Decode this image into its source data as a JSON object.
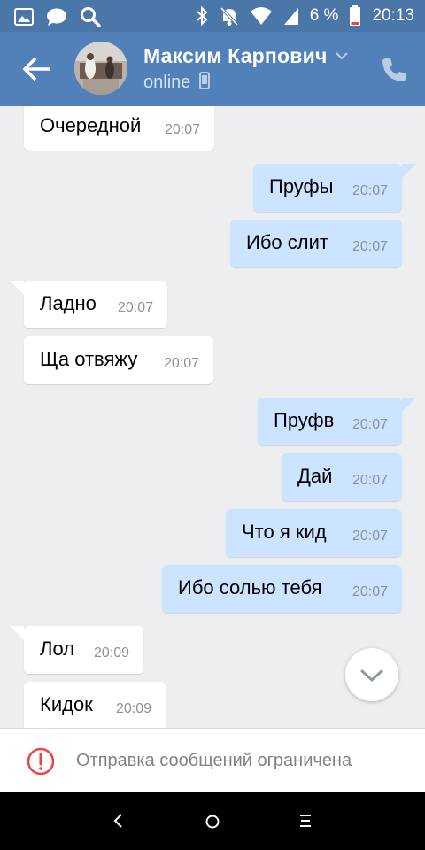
{
  "status_bar": {
    "battery_percent": "6 %",
    "time": "20:13"
  },
  "header": {
    "contact_name": "Максим Карпович",
    "presence": "online"
  },
  "messages": [
    {
      "dir": "in",
      "text": "Очередной",
      "time": "20:07"
    },
    {
      "dir": "out",
      "text": "Пруфы",
      "time": "20:07"
    },
    {
      "dir": "out",
      "text": "Ибо слит",
      "time": "20:07"
    },
    {
      "dir": "in",
      "text": "Ладно",
      "time": "20:07"
    },
    {
      "dir": "in",
      "text": "Ща отвяжу",
      "time": "20:07"
    },
    {
      "dir": "out",
      "text": "Пруфв",
      "time": "20:07"
    },
    {
      "dir": "out",
      "text": "Дай",
      "time": "20:07"
    },
    {
      "dir": "out",
      "text": "Что я кид",
      "time": "20:07"
    },
    {
      "dir": "out",
      "text": "Ибо солью тебя",
      "time": "20:07"
    },
    {
      "dir": "in",
      "text": "Лол",
      "time": "20:09"
    },
    {
      "dir": "in",
      "text": "Кидок",
      "time": "20:09"
    }
  ],
  "footer": {
    "restricted_text": "Отправка сообщений ограничена"
  },
  "colors": {
    "header_bg": "#5181b8",
    "statusbar_bg": "#4a76a8",
    "incoming_bubble": "#ffffff",
    "outgoing_bubble": "#cce4ff",
    "chat_bg": "#edeef0",
    "warning": "#e64646"
  },
  "icons": [
    "gallery-icon",
    "chat-notification-icon",
    "search-icon",
    "bluetooth-icon",
    "mute-icon",
    "wifi-icon",
    "signal-icon",
    "battery-icon",
    "back-arrow-icon",
    "chevron-down-icon",
    "mobile-device-icon",
    "phone-icon",
    "scroll-down-chevron-icon",
    "warning-icon",
    "nav-back-icon",
    "nav-home-icon",
    "nav-menu-icon"
  ]
}
